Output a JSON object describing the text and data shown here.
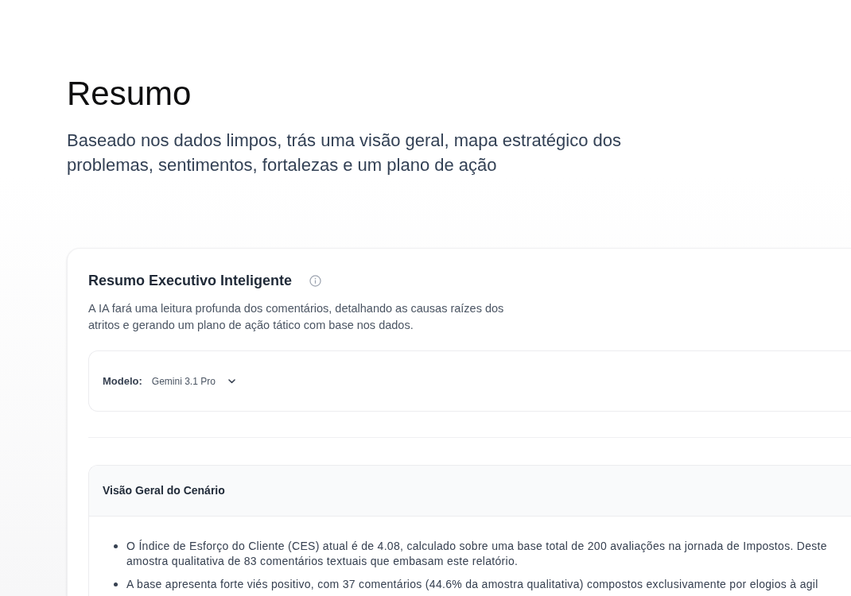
{
  "header": {
    "title": "Resumo",
    "subtitle": "Baseado nos dados limpos, trás uma visão geral, mapa estratégico dos problemas, sentimentos, fortalezas e um plano de ação"
  },
  "card": {
    "title": "Resumo Executivo Inteligente",
    "description": "A IA fará uma leitura profunda dos comentários, detalhando as causas raízes dos atritos e gerando um plano de ação tático com base nos dados.",
    "model_selector": {
      "label": "Modelo:",
      "value": "Gemini 3.1 Pro"
    },
    "overview": {
      "title": "Visão Geral do Cenário",
      "bullets": [
        {
          "lines": [
            "O Índice de Esforço do Cliente (CES) atual é de 4.08, calculado sobre uma base total de 200 avaliações na jornada de Impostos. Deste",
            "amostra qualitativa de 83 comentários textuais que embasam este relatório."
          ]
        },
        {
          "lines": [
            "A base apresenta forte viés positivo, com 37 comentários (44.6% da amostra qualitativa) compostos exclusivamente por elogios à agil"
          ]
        }
      ]
    }
  }
}
